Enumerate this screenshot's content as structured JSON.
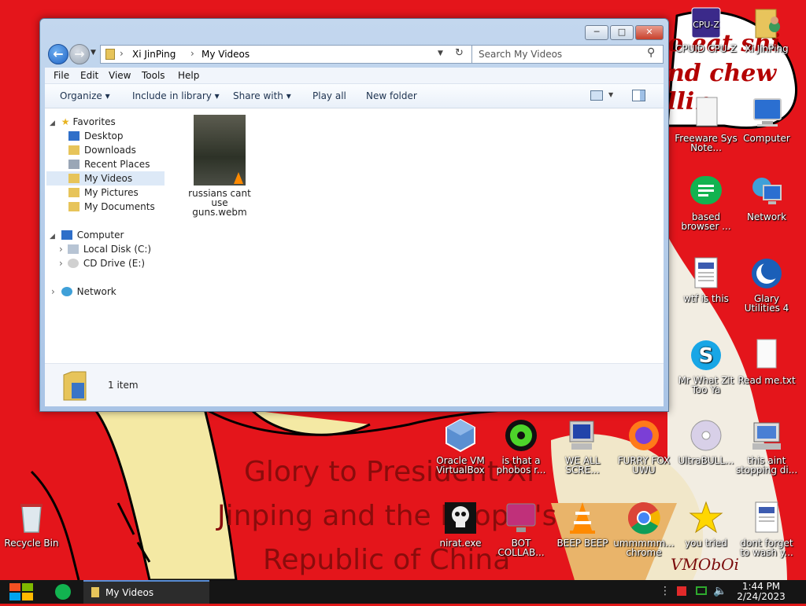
{
  "wallpaper": {
    "text_lines": [
      "Glory to President Xi",
      "Jinping and the People's",
      "Republic of China"
    ],
    "red_text_lines": [
      "o eat shi",
      "nd chew",
      "llin"
    ],
    "signature": "VMObOi"
  },
  "desktop_icons": {
    "cpuz": {
      "label": "CPUID CPU-Z",
      "icon": "cpuz-icon"
    },
    "xi": {
      "label": "Xi JinPing",
      "icon": "user-folder-icon"
    },
    "freeware": {
      "label": "Freeware Sys Note...",
      "icon": "document-icon"
    },
    "computer": {
      "label": "Computer",
      "icon": "computer-icon"
    },
    "based": {
      "label": "based browser ...",
      "icon": "browser-icon"
    },
    "network": {
      "label": "Network",
      "icon": "network-icon"
    },
    "wtf": {
      "label": "wtf is this",
      "icon": "file-icon"
    },
    "glary": {
      "label": "Glary Utilities 4",
      "icon": "glary-icon"
    },
    "skype": {
      "label": "Mr What Zit Too Ya",
      "icon": "skype-icon"
    },
    "readme": {
      "label": "Read me.txt",
      "icon": "text-file-icon"
    },
    "oracle": {
      "label": "Oracle VM VirtualBox",
      "icon": "virtualbox-icon"
    },
    "phobos": {
      "label": "is that a phobos r...",
      "icon": "icq-icon"
    },
    "weall": {
      "label": "WE ALL SCRE...",
      "icon": "computer-scream-icon"
    },
    "furry": {
      "label": "FURRY FOX UWU",
      "icon": "firefox-icon"
    },
    "ultrabull": {
      "label": "UltraBULL...",
      "icon": "disc-icon"
    },
    "thisaint": {
      "label": "this aint stopping di...",
      "icon": "install-icon"
    },
    "recycle": {
      "label": "Recycle Bin",
      "icon": "recycle-bin-icon"
    },
    "nirat": {
      "label": "nirat.exe",
      "icon": "skull-icon"
    },
    "bot": {
      "label": "BOT COLLAB...",
      "icon": "monitor-icon"
    },
    "beep": {
      "label": "BEEP BEEP",
      "icon": "vlc-icon"
    },
    "chrome": {
      "label": "ummmmm... chrome",
      "icon": "chrome-icon"
    },
    "youtried": {
      "label": "you tried",
      "icon": "star-icon"
    },
    "dontforget": {
      "label": "dont forget to wash y...",
      "icon": "file-icon"
    }
  },
  "window": {
    "breadcrumb": [
      "Xi JinPing",
      "My Videos"
    ],
    "search_placeholder": "Search My Videos",
    "menu": [
      "File",
      "Edit",
      "View",
      "Tools",
      "Help"
    ],
    "toolbar": {
      "organize": "Organize",
      "include": "Include in library",
      "share": "Share with",
      "play": "Play all",
      "newfolder": "New folder"
    },
    "nav": {
      "favorites": "Favorites",
      "desktop": "Desktop",
      "downloads": "Downloads",
      "recent": "Recent Places",
      "videos": "My Videos",
      "pictures": "My Pictures",
      "documents": "My Documents",
      "computer": "Computer",
      "localdisk": "Local Disk (C:)",
      "cddrive": "CD Drive (E:)",
      "network": "Network"
    },
    "file": {
      "name": "russians cant use guns.webm"
    },
    "status": "1 item"
  },
  "taskbar": {
    "task_label": "My Videos",
    "time": "1:44 PM",
    "date": "2/24/2023"
  }
}
